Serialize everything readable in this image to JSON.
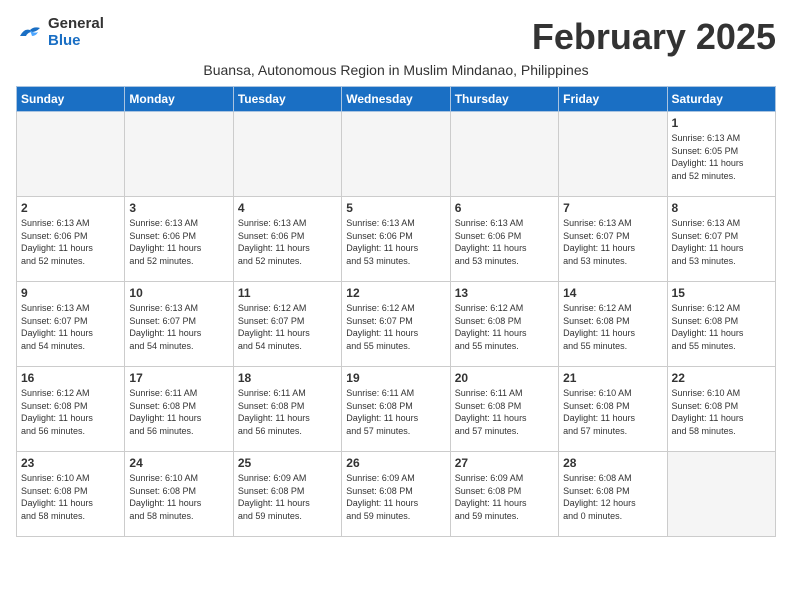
{
  "logo": {
    "general": "General",
    "blue": "Blue"
  },
  "title": "February 2025",
  "subtitle": "Buansa, Autonomous Region in Muslim Mindanao, Philippines",
  "days_of_week": [
    "Sunday",
    "Monday",
    "Tuesday",
    "Wednesday",
    "Thursday",
    "Friday",
    "Saturday"
  ],
  "weeks": [
    [
      {
        "day": "",
        "info": ""
      },
      {
        "day": "",
        "info": ""
      },
      {
        "day": "",
        "info": ""
      },
      {
        "day": "",
        "info": ""
      },
      {
        "day": "",
        "info": ""
      },
      {
        "day": "",
        "info": ""
      },
      {
        "day": "1",
        "info": "Sunrise: 6:13 AM\nSunset: 6:05 PM\nDaylight: 11 hours\nand 52 minutes."
      }
    ],
    [
      {
        "day": "2",
        "info": "Sunrise: 6:13 AM\nSunset: 6:06 PM\nDaylight: 11 hours\nand 52 minutes."
      },
      {
        "day": "3",
        "info": "Sunrise: 6:13 AM\nSunset: 6:06 PM\nDaylight: 11 hours\nand 52 minutes."
      },
      {
        "day": "4",
        "info": "Sunrise: 6:13 AM\nSunset: 6:06 PM\nDaylight: 11 hours\nand 52 minutes."
      },
      {
        "day": "5",
        "info": "Sunrise: 6:13 AM\nSunset: 6:06 PM\nDaylight: 11 hours\nand 53 minutes."
      },
      {
        "day": "6",
        "info": "Sunrise: 6:13 AM\nSunset: 6:06 PM\nDaylight: 11 hours\nand 53 minutes."
      },
      {
        "day": "7",
        "info": "Sunrise: 6:13 AM\nSunset: 6:07 PM\nDaylight: 11 hours\nand 53 minutes."
      },
      {
        "day": "8",
        "info": "Sunrise: 6:13 AM\nSunset: 6:07 PM\nDaylight: 11 hours\nand 53 minutes."
      }
    ],
    [
      {
        "day": "9",
        "info": "Sunrise: 6:13 AM\nSunset: 6:07 PM\nDaylight: 11 hours\nand 54 minutes."
      },
      {
        "day": "10",
        "info": "Sunrise: 6:13 AM\nSunset: 6:07 PM\nDaylight: 11 hours\nand 54 minutes."
      },
      {
        "day": "11",
        "info": "Sunrise: 6:12 AM\nSunset: 6:07 PM\nDaylight: 11 hours\nand 54 minutes."
      },
      {
        "day": "12",
        "info": "Sunrise: 6:12 AM\nSunset: 6:07 PM\nDaylight: 11 hours\nand 55 minutes."
      },
      {
        "day": "13",
        "info": "Sunrise: 6:12 AM\nSunset: 6:08 PM\nDaylight: 11 hours\nand 55 minutes."
      },
      {
        "day": "14",
        "info": "Sunrise: 6:12 AM\nSunset: 6:08 PM\nDaylight: 11 hours\nand 55 minutes."
      },
      {
        "day": "15",
        "info": "Sunrise: 6:12 AM\nSunset: 6:08 PM\nDaylight: 11 hours\nand 55 minutes."
      }
    ],
    [
      {
        "day": "16",
        "info": "Sunrise: 6:12 AM\nSunset: 6:08 PM\nDaylight: 11 hours\nand 56 minutes."
      },
      {
        "day": "17",
        "info": "Sunrise: 6:11 AM\nSunset: 6:08 PM\nDaylight: 11 hours\nand 56 minutes."
      },
      {
        "day": "18",
        "info": "Sunrise: 6:11 AM\nSunset: 6:08 PM\nDaylight: 11 hours\nand 56 minutes."
      },
      {
        "day": "19",
        "info": "Sunrise: 6:11 AM\nSunset: 6:08 PM\nDaylight: 11 hours\nand 57 minutes."
      },
      {
        "day": "20",
        "info": "Sunrise: 6:11 AM\nSunset: 6:08 PM\nDaylight: 11 hours\nand 57 minutes."
      },
      {
        "day": "21",
        "info": "Sunrise: 6:10 AM\nSunset: 6:08 PM\nDaylight: 11 hours\nand 57 minutes."
      },
      {
        "day": "22",
        "info": "Sunrise: 6:10 AM\nSunset: 6:08 PM\nDaylight: 11 hours\nand 58 minutes."
      }
    ],
    [
      {
        "day": "23",
        "info": "Sunrise: 6:10 AM\nSunset: 6:08 PM\nDaylight: 11 hours\nand 58 minutes."
      },
      {
        "day": "24",
        "info": "Sunrise: 6:10 AM\nSunset: 6:08 PM\nDaylight: 11 hours\nand 58 minutes."
      },
      {
        "day": "25",
        "info": "Sunrise: 6:09 AM\nSunset: 6:08 PM\nDaylight: 11 hours\nand 59 minutes."
      },
      {
        "day": "26",
        "info": "Sunrise: 6:09 AM\nSunset: 6:08 PM\nDaylight: 11 hours\nand 59 minutes."
      },
      {
        "day": "27",
        "info": "Sunrise: 6:09 AM\nSunset: 6:08 PM\nDaylight: 11 hours\nand 59 minutes."
      },
      {
        "day": "28",
        "info": "Sunrise: 6:08 AM\nSunset: 6:08 PM\nDaylight: 12 hours\nand 0 minutes."
      },
      {
        "day": "",
        "info": ""
      }
    ]
  ]
}
